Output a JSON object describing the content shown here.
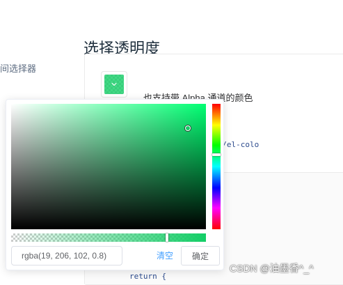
{
  "sidebar": {
    "snippet": "间选择器"
  },
  "page": {
    "title": "选择透明度"
  },
  "demo": {
    "description": "也支持带 Alpha 通道的颜色",
    "code_line_1": "olor\" show-alpha></el-colo",
    "code_line_2": "return {"
  },
  "color_picker": {
    "selected_color": "#13ce66",
    "hue_fraction": 0.408,
    "saturation_fraction": 0.907,
    "value_fraction": 0.807,
    "alpha": 0.8,
    "input_value": "rgba(19, 206, 102, 0.8)",
    "clear_label": "清空",
    "confirm_label": "确定",
    "trigger_icon": "chevron-down-icon"
  },
  "watermark": {
    "text": "CSDN @油墨香^_^"
  }
}
